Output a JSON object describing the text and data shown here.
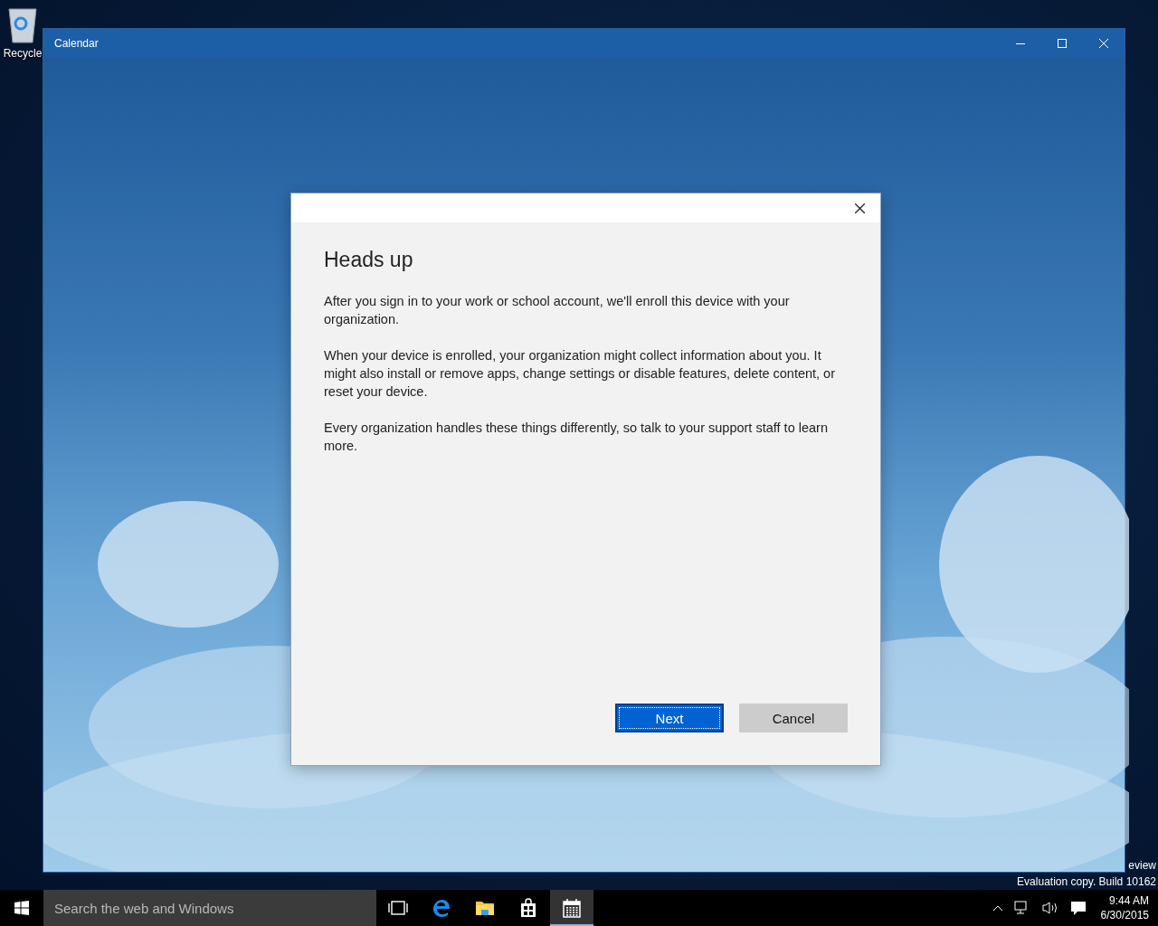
{
  "desktop": {
    "icons": [
      {
        "label": "Recycle"
      }
    ],
    "build_notice": [
      "eview",
      "Evaluation copy. Build 10162"
    ]
  },
  "window": {
    "title": "Calendar"
  },
  "dialog": {
    "title": "Heads up",
    "paragraphs": [
      "After you sign in to your work or school account, we'll enroll this device with your organization.",
      "When your device is enrolled, your organization might collect information about you. It might also install or remove apps, change settings or disable features, delete content, or reset your device.",
      "Every organization handles these things differently, so talk to your support staff to learn more."
    ],
    "buttons": [
      {
        "label": "Next",
        "kind": "primary"
      },
      {
        "label": "Cancel",
        "kind": "secondary"
      }
    ]
  },
  "taskbar": {
    "search": {
      "placeholder": "Search the web and Windows"
    },
    "apps": [
      {
        "kind": "task-view",
        "selected": false
      },
      {
        "kind": "browser",
        "selected": false
      },
      {
        "kind": "folder",
        "selected": false
      },
      {
        "kind": "store",
        "selected": false
      },
      {
        "kind": "calendar",
        "selected": true
      }
    ],
    "clock": {
      "time": "9:44 AM",
      "date": "6/30/2015"
    }
  }
}
